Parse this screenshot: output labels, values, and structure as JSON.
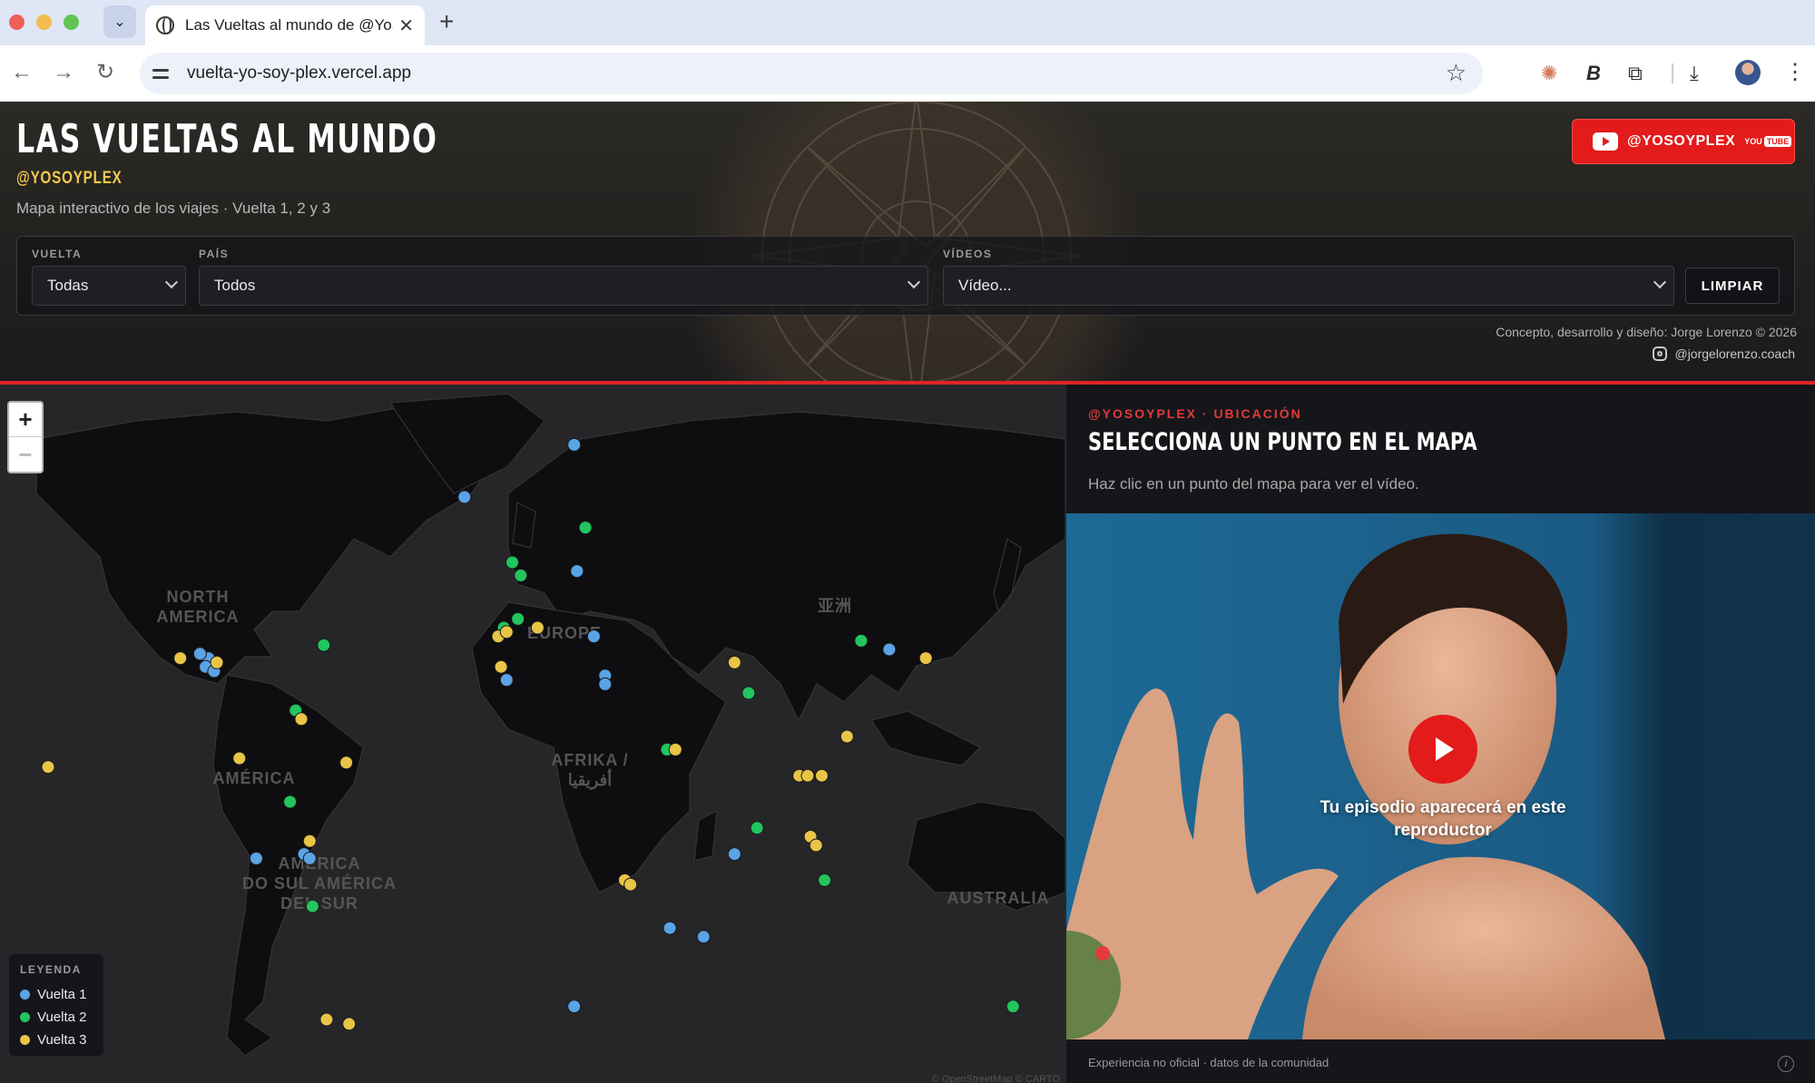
{
  "browser": {
    "tab_title": "Las Vueltas al mundo de @YoSoyPlex",
    "url": "vuelta-yo-soy-plex.vercel.app",
    "icons": [
      "tab-list-icon",
      "globe-icon",
      "close-icon",
      "new-tab-icon",
      "back-icon",
      "forward-icon",
      "reload-icon",
      "site-info-icon",
      "star-icon",
      "claude-extension-icon",
      "bold-extension-icon",
      "puzzle-icon",
      "download-icon",
      "profile-avatar",
      "kebab-menu-icon"
    ]
  },
  "header": {
    "title": "LAS VUELTAS AL MUNDO",
    "handle": "@YOSOYPLEX",
    "subtitle": "Mapa interactivo de los viajes · Vuelta 1, 2 y 3",
    "youtube_handle": "@YOSOYPLEX",
    "youtube_word": "YOU",
    "youtube_tube": "TUBE"
  },
  "filters": {
    "vuelta_label": "VUELTA",
    "vuelta_value": "Todas",
    "pais_label": "PAÍS",
    "pais_value": "Todos",
    "videos_label": "VÍDEOS",
    "videos_value": "Vídeo...",
    "clear_label": "LIMPIAR"
  },
  "credit": {
    "line": "Concepto, desarrollo y diseño: Jorge Lorenzo © 2026",
    "instagram": "@jorgelorenzo.coach"
  },
  "map": {
    "zoom_in": "+",
    "zoom_out": "−",
    "labels": {
      "north_america_1": "NORTH",
      "north_america_2": "AMERICA",
      "europe": "EUROPE",
      "asia": "亚洲",
      "africa": "AFRIKA /",
      "africa_ar": "أفريقيا",
      "south_america_1": "AMÉRICA",
      "south_america_2": "DO SUL AMÉRICA",
      "south_america_3": "DEL SUR",
      "central_america": "AMÉRICA",
      "australia": "AUSTRALIA"
    },
    "attribution": "© OpenStreetMap © CARTO",
    "colors": {
      "vuelta1": "#5aa3e6",
      "vuelta2": "#22c55e",
      "vuelta3": "#e8c547"
    },
    "points": [
      {
        "v": 1,
        "lon": -113,
        "lat": 33
      },
      {
        "v": 1,
        "lon": -116,
        "lat": 34
      },
      {
        "v": 1,
        "lon": -114,
        "lat": 31
      },
      {
        "v": 1,
        "lon": -111,
        "lat": 30
      },
      {
        "v": 3,
        "lon": -123,
        "lat": 33
      },
      {
        "v": 3,
        "lon": -110,
        "lat": 32
      },
      {
        "v": 2,
        "lon": -72,
        "lat": 36
      },
      {
        "v": 2,
        "lon": -82,
        "lat": 21
      },
      {
        "v": 3,
        "lon": -80,
        "lat": 19
      },
      {
        "v": 3,
        "lon": -102,
        "lat": 10
      },
      {
        "v": 3,
        "lon": -64,
        "lat": 9
      },
      {
        "v": 2,
        "lon": -84,
        "lat": 0
      },
      {
        "v": 3,
        "lon": -77,
        "lat": -9
      },
      {
        "v": 1,
        "lon": -79,
        "lat": -12
      },
      {
        "v": 1,
        "lon": -77,
        "lat": -13
      },
      {
        "v": 1,
        "lon": -96,
        "lat": -13
      },
      {
        "v": 2,
        "lon": -76,
        "lat": -24
      },
      {
        "v": 3,
        "lon": -71,
        "lat": -50
      },
      {
        "v": 3,
        "lon": -63,
        "lat": -51
      },
      {
        "v": 2,
        "lon": -73,
        "lat": -68
      },
      {
        "v": 2,
        "lon": -73,
        "lat": -70
      },
      {
        "v": 3,
        "lon": -170,
        "lat": 8
      },
      {
        "v": 1,
        "lon": -22,
        "lat": 70
      },
      {
        "v": 1,
        "lon": 17,
        "lat": 82
      },
      {
        "v": 2,
        "lon": 21,
        "lat": 63
      },
      {
        "v": 2,
        "lon": -5,
        "lat": 55
      },
      {
        "v": 2,
        "lon": -2,
        "lat": 52
      },
      {
        "v": 1,
        "lon": 18,
        "lat": 53
      },
      {
        "v": 2,
        "lon": -8,
        "lat": 40
      },
      {
        "v": 3,
        "lon": -10,
        "lat": 38
      },
      {
        "v": 3,
        "lon": -7,
        "lat": 39
      },
      {
        "v": 2,
        "lon": -3,
        "lat": 42
      },
      {
        "v": 3,
        "lon": 4,
        "lat": 40
      },
      {
        "v": 1,
        "lon": 24,
        "lat": 38
      },
      {
        "v": 3,
        "lon": -9,
        "lat": 31
      },
      {
        "v": 1,
        "lon": -7,
        "lat": 28
      },
      {
        "v": 1,
        "lon": 28,
        "lat": 29
      },
      {
        "v": 1,
        "lon": 28,
        "lat": 27
      },
      {
        "v": 2,
        "lon": 50,
        "lat": 12
      },
      {
        "v": 3,
        "lon": 53,
        "lat": 12
      },
      {
        "v": 3,
        "lon": 74,
        "lat": 32
      },
      {
        "v": 2,
        "lon": 79,
        "lat": 25
      },
      {
        "v": 1,
        "lon": 74,
        "lat": -12
      },
      {
        "v": 2,
        "lon": 82,
        "lat": -6
      },
      {
        "v": 3,
        "lon": 97,
        "lat": 6
      },
      {
        "v": 3,
        "lon": 100,
        "lat": 6
      },
      {
        "v": 3,
        "lon": 105,
        "lat": 6
      },
      {
        "v": 3,
        "lon": 114,
        "lat": 15
      },
      {
        "v": 2,
        "lon": 119,
        "lat": 37
      },
      {
        "v": 1,
        "lon": 129,
        "lat": 35
      },
      {
        "v": 3,
        "lon": 142,
        "lat": 33
      },
      {
        "v": 3,
        "lon": 101,
        "lat": -8
      },
      {
        "v": 3,
        "lon": 103,
        "lat": -10
      },
      {
        "v": 2,
        "lon": 106,
        "lat": -18
      },
      {
        "v": 3,
        "lon": 35,
        "lat": -18
      },
      {
        "v": 3,
        "lon": 37,
        "lat": -19
      },
      {
        "v": 1,
        "lon": 51,
        "lat": -29
      },
      {
        "v": 1,
        "lon": 63,
        "lat": -31
      },
      {
        "v": 1,
        "lon": 17,
        "lat": -47
      },
      {
        "v": 2,
        "lon": 173,
        "lat": -47
      }
    ]
  },
  "legend": {
    "title": "LEYENDA",
    "items": [
      {
        "label": "Vuelta 1",
        "color": "#5aa3e6"
      },
      {
        "label": "Vuelta 2",
        "color": "#22c55e"
      },
      {
        "label": "Vuelta 3",
        "color": "#e8c547"
      }
    ]
  },
  "panel": {
    "kicker": "@YOSOYPLEX · UBICACIÓN",
    "title": "SELECCIONA UN PUNTO EN EL MAPA",
    "description": "Haz clic en un punto del mapa para ver el vídeo.",
    "video_caption": "Tu episodio aparecerá en este reproductor",
    "footer": "Experiencia no oficial · datos de la comunidad",
    "info": "i"
  }
}
